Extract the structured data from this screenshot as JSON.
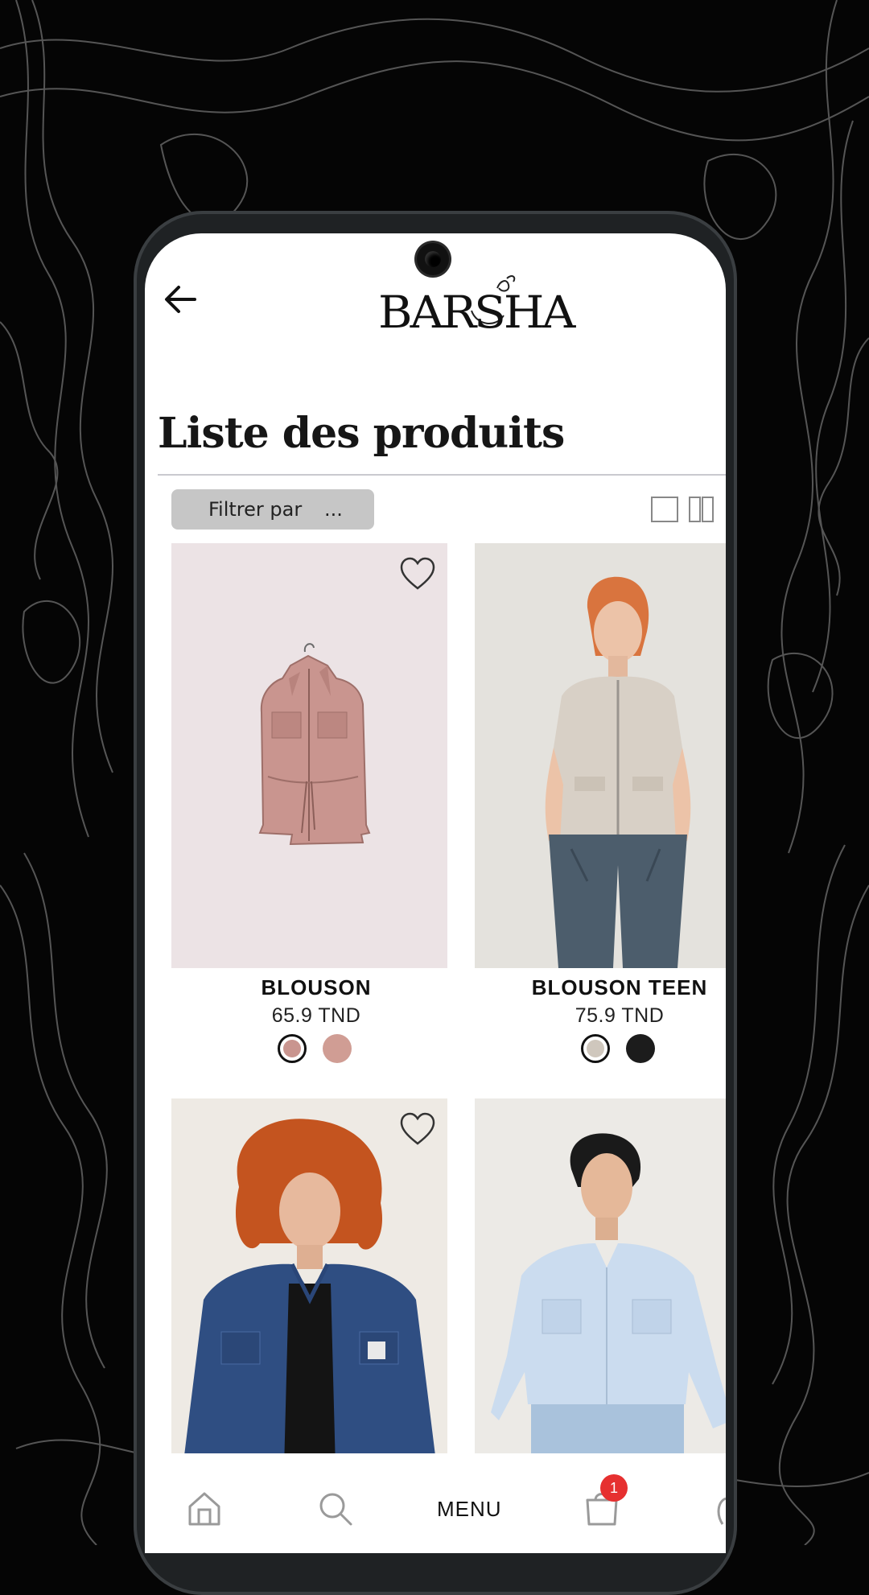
{
  "header": {
    "brand_name": "BARSHA",
    "back_icon": "arrow-left-icon"
  },
  "page": {
    "title": "Liste des produits"
  },
  "toolbar": {
    "filter_label": "Filtrer par",
    "filter_more": "...",
    "view_single_icon": "single-column-icon",
    "view_double_icon": "two-column-icon"
  },
  "products": [
    {
      "name": "BLOUSON",
      "price": "65.9 TND",
      "swatches": [
        {
          "color": "#c9958f",
          "selected": true
        },
        {
          "color": "#d09d94",
          "selected": false
        }
      ],
      "favorite_icon": "heart-outline-icon"
    },
    {
      "name": "BLOUSON TEEN",
      "price": "75.9 TND",
      "swatches": [
        {
          "color": "#cfc7bd",
          "selected": true
        },
        {
          "color": "#1c1c1c",
          "selected": false
        }
      ],
      "favorite_icon": "heart-outline-icon"
    },
    {
      "name": "",
      "price": "",
      "swatches": [],
      "favorite_icon": "heart-outline-icon"
    },
    {
      "name": "",
      "price": "",
      "swatches": [],
      "favorite_icon": "heart-outline-icon"
    }
  ],
  "bottom_nav": {
    "home_icon": "home-icon",
    "search_icon": "search-icon",
    "menu_label": "MENU",
    "cart_icon": "shopping-bag-icon",
    "cart_count": "1"
  },
  "colors": {
    "accent_badge": "#e63030",
    "filter_bg": "#c6c6c6",
    "background": "#050505"
  }
}
